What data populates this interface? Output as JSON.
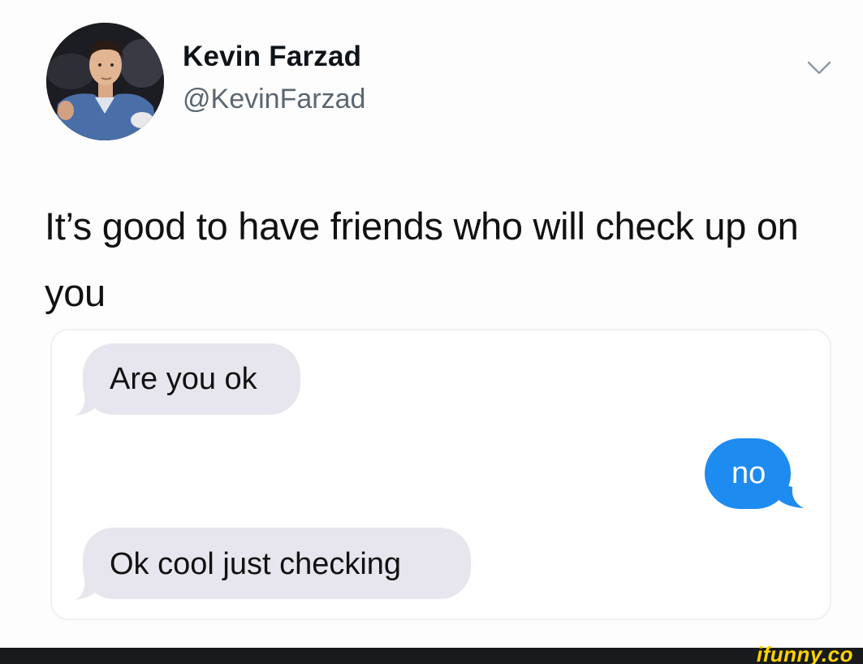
{
  "author": {
    "display_name": "Kevin Farzad",
    "handle": "@KevinFarzad",
    "avatar_icon": "profile-photo"
  },
  "tweet": {
    "text": "It’s good to have friends who will check up on you",
    "menu_icon": "chevron-down-icon"
  },
  "conversation": {
    "messages": [
      {
        "from": "them",
        "text": "Are you ok"
      },
      {
        "from": "me",
        "text": "no"
      },
      {
        "from": "them",
        "text": "Ok cool just checking"
      }
    ],
    "received_color": "#e7e6ee",
    "sent_color": "#1e8bf0"
  },
  "watermark": {
    "text": "ifunny.co",
    "color": "#ffd200"
  }
}
